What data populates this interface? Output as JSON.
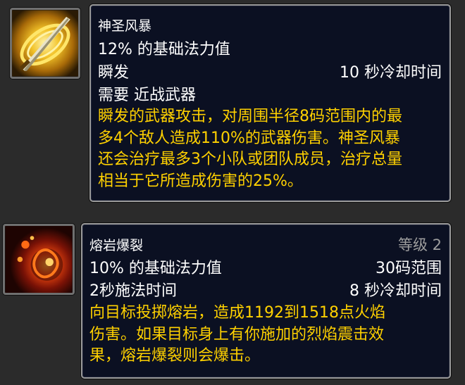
{
  "icons": {
    "first": "divine-storm-icon",
    "second": "lava-burst-icon"
  },
  "colors": {
    "tooltip_bg": "#0b1022",
    "tooltip_border": "#9a9a9a",
    "text_white": "#ffffff",
    "text_yellow": "#ffd100",
    "text_gray": "#9d9d9d"
  },
  "spells": [
    {
      "name": "神圣风暴",
      "cost": "12% 的基础法力值",
      "cast_time": "瞬发",
      "cooldown": "10 秒冷却时间",
      "requirement": "需要 近战武器",
      "description_lines": [
        "瞬发的武器攻击，对周围半径8码范围内的最",
        "多4个敌人造成110%的武器伤害。神圣风暴",
        "还会治疗最多3个小队或团队成员，治疗总量",
        "相当于它所造成伤害的25%。"
      ]
    },
    {
      "name": "熔岩爆裂",
      "rank": "等级 2",
      "cost": "10% 的基础法力值",
      "range": "30码范围",
      "cast_time": "2秒施法时间",
      "cooldown": "8 秒冷却时间",
      "description_lines": [
        "向目标投掷熔岩，造成1192到1518点火焰",
        "伤害。如果目标身上有你施加的烈焰震击效",
        "果，熔岩爆裂则会爆击。"
      ]
    }
  ]
}
